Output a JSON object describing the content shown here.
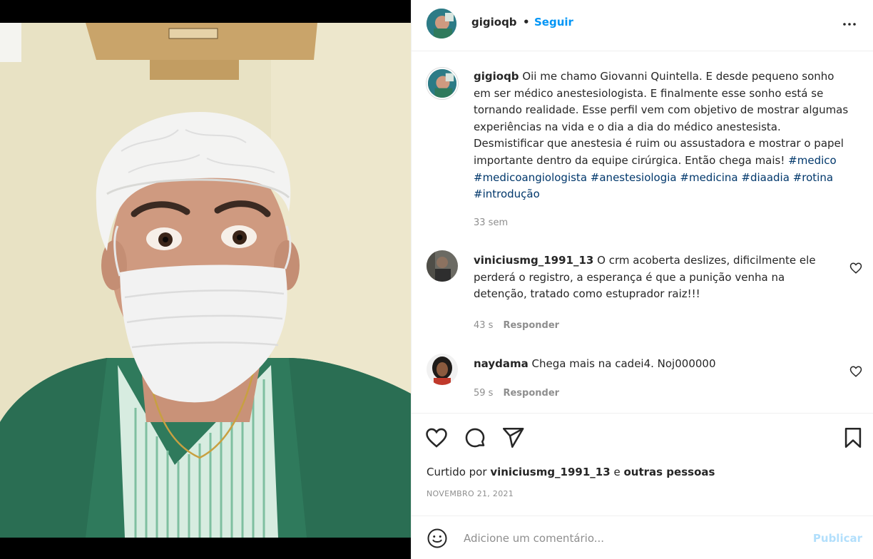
{
  "post": {
    "username": "gigioqb",
    "dot": "•",
    "follow_label": "Seguir",
    "more_icon": "more-horizontal-icon"
  },
  "caption": {
    "username": "gigioqb",
    "text": "Oii me chamo Giovanni Quintella. E desde pequeno sonho em ser médico anestesiologista. E finalmente esse sonho está se tornando realidade. Esse perfil vem com objetivo de mostrar algumas experiências na vida e o dia a dia do médico anestesista. Desmistificar que anestesia é ruim ou assustadora e mostrar o papel importante dentro da equipe cirúrgica. Então chega mais!",
    "hashtags": [
      "#medico",
      "#medicoangiologista",
      "#anestesiologia",
      "#medicina",
      "#diaadia",
      "#rotina",
      "#introdução"
    ],
    "time": "33 sem"
  },
  "comments": [
    {
      "username": "viniciusmg_1991_13",
      "text": "O crm acoberta deslizes, dificilmente ele perderá o registro, a esperança é que a punição venha na detenção, tratado como estuprador raiz!!!",
      "time": "43 s",
      "reply_label": "Responder"
    },
    {
      "username": "naydama",
      "text": "Chega mais na cadei4. Noj000000",
      "time": "59 s",
      "reply_label": "Responder"
    }
  ],
  "actions": {
    "liked_prefix": "Curtido por",
    "liked_user": "viniciusmg_1991_13",
    "liked_suffix": "e",
    "liked_others": "outras pessoas",
    "date": "NOVEMBRO 21, 2021"
  },
  "composer": {
    "placeholder": "Adicione um comentário...",
    "publish_label": "Publicar"
  },
  "colors": {
    "link": "#0095f6",
    "hashtag": "#00376b",
    "muted": "#8e8e8e",
    "publish_disabled": "#b2dffc"
  }
}
